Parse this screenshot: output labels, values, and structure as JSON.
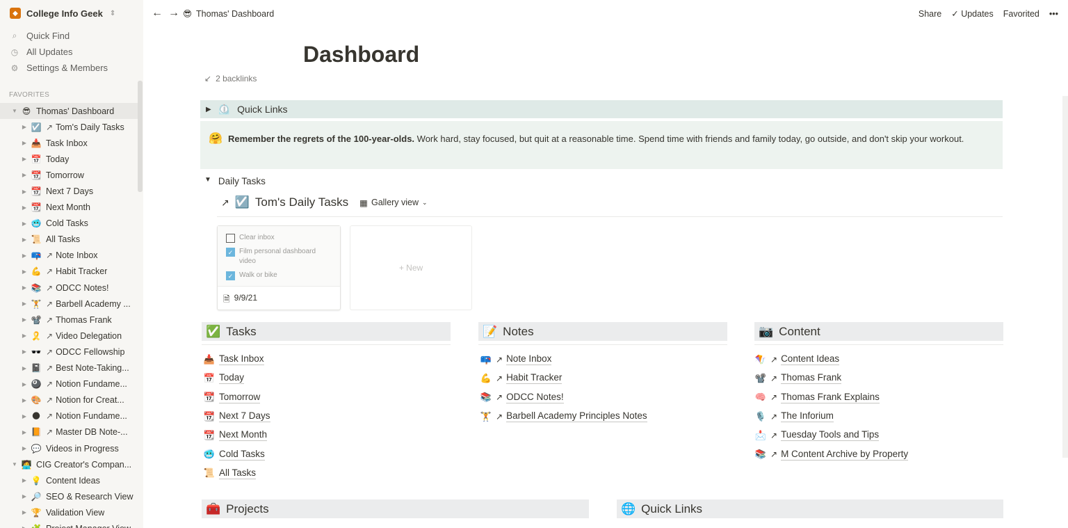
{
  "workspace": {
    "name": "College Info Geek",
    "icon": "notion-icon"
  },
  "sidebar_top": [
    {
      "label": "Quick Find",
      "icon": "search-icon"
    },
    {
      "label": "All Updates",
      "icon": "clock-icon"
    },
    {
      "label": "Settings & Members",
      "icon": "gear-icon"
    }
  ],
  "favorites_label": "FAVORITES",
  "sidebar_items": [
    {
      "label": "Thomas' Dashboard",
      "emoji": "😎",
      "arrow": "",
      "level": 1,
      "open": true
    },
    {
      "label": "Tom's Daily Tasks",
      "emoji": "☑️",
      "arrow": "↗",
      "level": 2
    },
    {
      "label": "Task Inbox",
      "emoji": "📥",
      "arrow": "",
      "level": 2
    },
    {
      "label": "Today",
      "emoji": "📅",
      "arrow": "",
      "level": 2
    },
    {
      "label": "Tomorrow",
      "emoji": "📆",
      "arrow": "",
      "level": 2
    },
    {
      "label": "Next 7 Days",
      "emoji": "📆",
      "arrow": "",
      "level": 2
    },
    {
      "label": "Next Month",
      "emoji": "📆",
      "arrow": "",
      "level": 2
    },
    {
      "label": "Cold Tasks",
      "emoji": "🥶",
      "arrow": "",
      "level": 2
    },
    {
      "label": "All Tasks",
      "emoji": "📜",
      "arrow": "",
      "level": 2
    },
    {
      "label": "Note Inbox",
      "emoji": "📪",
      "arrow": "↗",
      "level": 2
    },
    {
      "label": "Habit Tracker",
      "emoji": "💪",
      "arrow": "↗",
      "level": 2
    },
    {
      "label": "ODCC Notes!",
      "emoji": "📚",
      "arrow": "↗",
      "level": 2
    },
    {
      "label": "Barbell Academy ...",
      "emoji": "🏋️",
      "arrow": "↗",
      "level": 2
    },
    {
      "label": "Thomas Frank",
      "emoji": "📽️",
      "arrow": "↗",
      "level": 2
    },
    {
      "label": "Video Delegation",
      "emoji": "🎗️",
      "arrow": "↗",
      "level": 2
    },
    {
      "label": "ODCC Fellowship",
      "emoji": "🕶️",
      "arrow": "↗",
      "level": 2
    },
    {
      "label": "Best Note-Taking...",
      "emoji": "📓",
      "arrow": "↗",
      "level": 2
    },
    {
      "label": "Notion Fundame...",
      "emoji": "🎱",
      "arrow": "↗",
      "level": 2
    },
    {
      "label": "Notion for Creat...",
      "emoji": "🎨",
      "arrow": "↗",
      "level": 2
    },
    {
      "label": "Notion Fundame...",
      "emoji": "🌑",
      "arrow": "↗",
      "level": 2
    },
    {
      "label": "Master DB Note-...",
      "emoji": "📙",
      "arrow": "↗",
      "level": 2
    },
    {
      "label": "Videos in Progress",
      "emoji": "💬",
      "arrow": "",
      "level": 2
    },
    {
      "label": "CIG Creator's Compan...",
      "emoji": "🧑‍💻",
      "arrow": "",
      "level": 1,
      "open": true
    },
    {
      "label": "Content Ideas",
      "emoji": "💡",
      "arrow": "",
      "level": 2
    },
    {
      "label": "SEO & Research View",
      "emoji": "🔎",
      "arrow": "",
      "level": 2
    },
    {
      "label": "Validation View",
      "emoji": "🏆",
      "arrow": "",
      "level": 2
    },
    {
      "label": "Project Manager View",
      "emoji": "🧩",
      "arrow": "",
      "level": 2
    }
  ],
  "topbar": {
    "crumb_emoji": "😎",
    "crumb": "Thomas' Dashboard",
    "share": "Share",
    "updates": "Updates",
    "favorited": "Favorited",
    "more": "•••"
  },
  "page": {
    "title": "Dashboard",
    "backlinks": "2 backlinks"
  },
  "quick_links_toggle": {
    "emoji": "⏲️",
    "label": "Quick Links"
  },
  "callout": {
    "emoji": "🤗",
    "bold": "Remember the regrets of the 100-year-olds.",
    "text": " Work hard, stay focused, but quit at a reasonable time. Spend time with friends and family today, go outside, and don't skip your workout."
  },
  "daily_tasks": {
    "toggle": "Daily Tasks",
    "db_title": "Tom's Daily Tasks",
    "db_emoji": "☑️",
    "view": "Gallery view",
    "card": {
      "items": [
        {
          "text": "Clear inbox",
          "checked": false
        },
        {
          "text": "Film personal dashboard video",
          "checked": true
        },
        {
          "text": "Walk or bike",
          "checked": true
        }
      ],
      "date": "9/9/21"
    },
    "new_label": "+ New"
  },
  "sections": {
    "tasks": {
      "title": "Tasks",
      "emoji": "✅",
      "links": [
        {
          "emoji": "📥",
          "arrow": "",
          "text": "Task Inbox"
        },
        {
          "emoji": "📅",
          "arrow": "",
          "text": "Today"
        },
        {
          "emoji": "📆",
          "arrow": "",
          "text": "Tomorrow"
        },
        {
          "emoji": "📆",
          "arrow": "",
          "text": "Next 7 Days"
        },
        {
          "emoji": "📆",
          "arrow": "",
          "text": "Next Month"
        },
        {
          "emoji": "🥶",
          "arrow": "",
          "text": "Cold Tasks"
        },
        {
          "emoji": "📜",
          "arrow": "",
          "text": "All Tasks"
        }
      ]
    },
    "notes": {
      "title": "Notes",
      "emoji": "📝",
      "links": [
        {
          "emoji": "📪",
          "arrow": "↗",
          "text": "Note Inbox"
        },
        {
          "emoji": "💪",
          "arrow": "↗",
          "text": "Habit Tracker"
        },
        {
          "emoji": "📚",
          "arrow": "↗",
          "text": "ODCC Notes!"
        },
        {
          "emoji": "🏋️",
          "arrow": "↗",
          "text": "Barbell Academy Principles Notes"
        }
      ]
    },
    "content": {
      "title": "Content",
      "emoji": "📷",
      "links": [
        {
          "emoji": "🪁",
          "arrow": "↗",
          "text": "Content Ideas"
        },
        {
          "emoji": "📽️",
          "arrow": "↗",
          "text": "Thomas Frank"
        },
        {
          "emoji": "🧠",
          "arrow": "↗",
          "text": "Thomas Frank Explains"
        },
        {
          "emoji": "🎙️",
          "arrow": "↗",
          "text": "The Inforium"
        },
        {
          "emoji": "📩",
          "arrow": "↗",
          "text": "Tuesday Tools and Tips"
        },
        {
          "emoji": "📚",
          "arrow": "↗",
          "text": "M Content Archive by Property"
        }
      ]
    },
    "projects": {
      "title": "Projects",
      "emoji": "🧰"
    },
    "quick_links": {
      "title": "Quick Links",
      "emoji": "🌐"
    }
  }
}
